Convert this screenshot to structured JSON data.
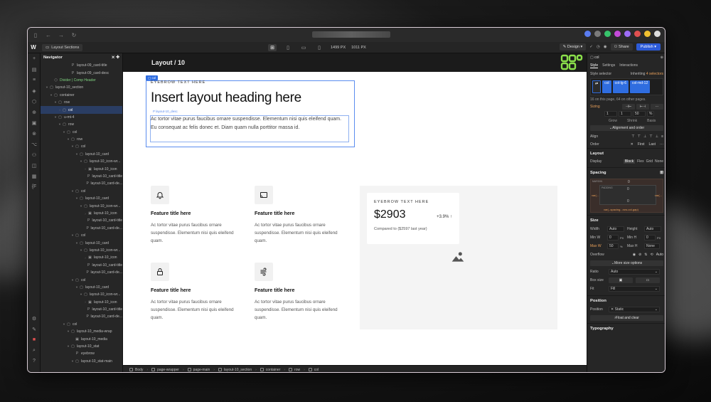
{
  "toolbar": {
    "page_name": "Layout Sections",
    "width_value": "1499",
    "width_unit": "PX",
    "height_value": "1011",
    "height_unit": "PX",
    "design_label": "Design",
    "share_label": "Share",
    "publish_label": "Publish"
  },
  "navigator": {
    "title": "Navigator",
    "rows": [
      {
        "depth": 6,
        "icon": "P",
        "label": "layout-09_card-title",
        "caret": ""
      },
      {
        "depth": 6,
        "icon": "P",
        "label": "layout-09_card-desc",
        "caret": ""
      },
      {
        "depth": 2,
        "icon": "⬡",
        "label": "Divider | Comp Header",
        "caret": "",
        "comp": true
      },
      {
        "depth": 1,
        "icon": "▢",
        "label": "layout-10_section",
        "caret": "▾"
      },
      {
        "depth": 2,
        "icon": "▢",
        "label": "container",
        "caret": "▾"
      },
      {
        "depth": 3,
        "icon": "▢",
        "label": "row",
        "caret": "▾"
      },
      {
        "depth": 4,
        "icon": "▢",
        "label": "col",
        "caret": "›",
        "selected": true
      },
      {
        "depth": 3,
        "icon": "▢",
        "label": "u-mt-4",
        "caret": "▾"
      },
      {
        "depth": 4,
        "icon": "▢",
        "label": "row",
        "caret": "▾"
      },
      {
        "depth": 5,
        "icon": "▢",
        "label": "col",
        "caret": "▾"
      },
      {
        "depth": 6,
        "icon": "▢",
        "label": "row",
        "caret": "▾"
      },
      {
        "depth": 7,
        "icon": "▢",
        "label": "col",
        "caret": "▾"
      },
      {
        "depth": 8,
        "icon": "▢",
        "label": "layout-10_card",
        "caret": "▾"
      },
      {
        "depth": 9,
        "icon": "▢",
        "label": "layout-10_icon-wr...",
        "caret": "▾"
      },
      {
        "depth": 10,
        "icon": "▣",
        "label": "layout-10_icon",
        "caret": "›"
      },
      {
        "depth": 10,
        "icon": "P",
        "label": "layout-10_card-title",
        "caret": ""
      },
      {
        "depth": 10,
        "icon": "P",
        "label": "layout-10_card-de...",
        "caret": ""
      },
      {
        "depth": 7,
        "icon": "▢",
        "label": "col",
        "caret": "▾"
      },
      {
        "depth": 8,
        "icon": "▢",
        "label": "layout-10_card",
        "caret": "▾"
      },
      {
        "depth": 9,
        "icon": "▢",
        "label": "layout-10_icon-wr...",
        "caret": "▾"
      },
      {
        "depth": 10,
        "icon": "▣",
        "label": "layout-10_icon",
        "caret": "›"
      },
      {
        "depth": 10,
        "icon": "P",
        "label": "layout-10_card-title",
        "caret": ""
      },
      {
        "depth": 10,
        "icon": "P",
        "label": "layout-10_card-de...",
        "caret": ""
      },
      {
        "depth": 7,
        "icon": "▢",
        "label": "col",
        "caret": "▾"
      },
      {
        "depth": 8,
        "icon": "▢",
        "label": "layout-10_card",
        "caret": "▾"
      },
      {
        "depth": 9,
        "icon": "▢",
        "label": "layout-10_icon-wr...",
        "caret": "▾"
      },
      {
        "depth": 10,
        "icon": "▣",
        "label": "layout-10_icon",
        "caret": "›"
      },
      {
        "depth": 10,
        "icon": "P",
        "label": "layout-10_card-title",
        "caret": ""
      },
      {
        "depth": 10,
        "icon": "P",
        "label": "layout-10_card-de...",
        "caret": ""
      },
      {
        "depth": 7,
        "icon": "▢",
        "label": "col",
        "caret": "▾"
      },
      {
        "depth": 8,
        "icon": "▢",
        "label": "layout-10_card",
        "caret": "▾"
      },
      {
        "depth": 9,
        "icon": "▢",
        "label": "layout-10_icon-wr...",
        "caret": "▾"
      },
      {
        "depth": 10,
        "icon": "▣",
        "label": "layout-10_icon",
        "caret": "›"
      },
      {
        "depth": 10,
        "icon": "P",
        "label": "layout-10_card-title",
        "caret": ""
      },
      {
        "depth": 10,
        "icon": "P",
        "label": "layout-10_card-de...",
        "caret": ""
      },
      {
        "depth": 5,
        "icon": "▢",
        "label": "col",
        "caret": "▾"
      },
      {
        "depth": 6,
        "icon": "▢",
        "label": "layout-10_media-wrap",
        "caret": "▾"
      },
      {
        "depth": 7,
        "icon": "▣",
        "label": "layout-10_media",
        "caret": ""
      },
      {
        "depth": 6,
        "icon": "▢",
        "label": "layout-10_stat",
        "caret": "▾"
      },
      {
        "depth": 7,
        "icon": "P",
        "label": "eyebrow",
        "caret": ""
      },
      {
        "depth": 7,
        "icon": "▢",
        "label": "layout-10_stat-main",
        "caret": "▾"
      }
    ]
  },
  "canvas": {
    "page_title": "Layout / 10",
    "col_tag": "col",
    "desc_tag": "layout-10_desc",
    "eyebrow": "EYEBROW TEXT HERE",
    "heading": "Insert layout heading here",
    "description": "Ac tortor vitae purus faucibus ornare suspendisse. Elementum nisi quis eleifend quam. Eu consequat ac felis donec et. Diam quam nulla porttitor massa id.",
    "features": [
      {
        "icon": "bell-icon",
        "title": "Feature title here",
        "text": "Ac tortor vitae purus faucibus ornare suspendisse. Elementum nisi quis eleifend quam."
      },
      {
        "icon": "cast-icon",
        "title": "Feature title here",
        "text": "Ac tortor vitae purus faucibus ornare suspendisse. Elementum nisi quis eleifend quam."
      },
      {
        "icon": "lock-icon",
        "title": "Feature title here",
        "text": "Ac tortor vitae purus faucibus ornare suspendisse. Elementum nisi quis eleifend quam."
      },
      {
        "icon": "wind-icon",
        "title": "Feature title here",
        "text": "Ac tortor vitae purus faucibus ornare suspendisse. Elementum nisi quis eleifend quam."
      }
    ],
    "stat": {
      "eyebrow": "EYEBROW TEXT HERE",
      "value": "$2903",
      "delta": "+3.9% ↑",
      "sub": "Compared to ($2597 last year)"
    }
  },
  "breadcrumb": [
    "Body",
    "page-wrapper",
    "page-main",
    "layout-10_section",
    "container",
    "row",
    "col"
  ],
  "style_panel": {
    "element": "col",
    "tabs": [
      "Style",
      "Settings",
      "Interactions"
    ],
    "selector_label": "Style selector",
    "inheriting": "Inheriting",
    "inheriting_count": "4 selectors",
    "chips": [
      "col",
      "col-lg-6",
      "col-md-12"
    ],
    "usage": "16 on this page, 64 on other pages.",
    "sizing_label": "Sizing",
    "grow": "Grow",
    "shrink": "Shrink",
    "basis": "Basis",
    "sizing_values": [
      "1",
      "1",
      "50",
      "%"
    ],
    "align_order_btn": "Alignment and order",
    "align_label": "Align",
    "order_label": "Order",
    "order_first": "First",
    "order_last": "Last",
    "layout_section": "Layout",
    "display_label": "Display",
    "display_options": [
      "Block",
      "Flex",
      "Grid",
      "None"
    ],
    "spacing_section": "Spacing",
    "spacing_margin_label": "MARGIN",
    "spacing_padding_label": "PADDING",
    "spacing_values": [
      "0",
      "0",
      "0",
      "0"
    ],
    "spacing_var_left": "var(...",
    "spacing_var_right": "var(...",
    "spacing_var_bottom": "var(--spacing...row-col-gap)",
    "size_section": "Size",
    "width_label": "Width",
    "width_val": "Auto",
    "height_label": "Height",
    "height_val": "Auto",
    "minw_label": "Min W",
    "minw_val": "0",
    "minw_unit": "PX",
    "minh_label": "Min H",
    "minh_val": "0",
    "minh_unit": "PX",
    "maxw_label": "Max W",
    "maxw_val": "50",
    "maxw_unit": "%",
    "maxh_label": "Max H",
    "maxh_val": "None",
    "overflow_label": "Overflow",
    "overflow_auto": "Auto",
    "more_size": "More size options",
    "ratio_label": "Ratio",
    "ratio_val": "Auto",
    "boxsize_label": "Box size",
    "fit_label": "Fit",
    "fit_val": "Fill",
    "position_section": "Position",
    "position_label": "Position",
    "position_val": "Static",
    "float_btn": "Float and clear",
    "typography_section": "Typography"
  },
  "colors": {
    "accent": "#2f6de0",
    "logo_green": "#8be04b",
    "selection": "#5b8def"
  }
}
